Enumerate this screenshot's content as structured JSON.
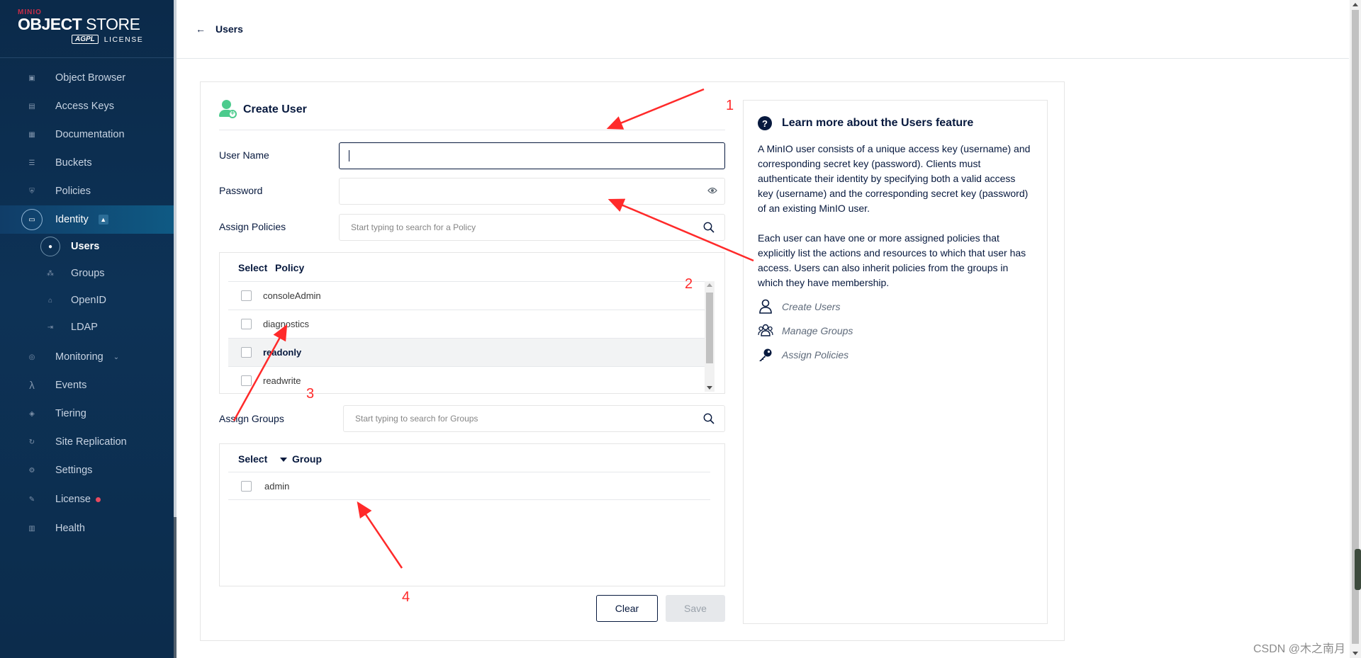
{
  "brand": {
    "line1": "MINIO",
    "title_bold": "OBJECT",
    "title_light": " STORE",
    "badge": "AGPL",
    "license": "LICENSE"
  },
  "nav": {
    "items": [
      {
        "label": "Object Browser",
        "icon": "object-browser-icon"
      },
      {
        "label": "Access Keys",
        "icon": "access-keys-icon"
      },
      {
        "label": "Documentation",
        "icon": "documentation-icon"
      },
      {
        "label": "Buckets",
        "icon": "buckets-icon"
      },
      {
        "label": "Policies",
        "icon": "policies-icon"
      },
      {
        "label": "Identity",
        "icon": "identity-icon"
      }
    ],
    "identity_sub": [
      {
        "label": "Users",
        "icon": "user-icon"
      },
      {
        "label": "Groups",
        "icon": "groups-icon"
      },
      {
        "label": "OpenID",
        "icon": "lock-icon"
      },
      {
        "label": "LDAP",
        "icon": "login-icon"
      }
    ],
    "items_after": [
      {
        "label": "Monitoring",
        "icon": "monitoring-icon"
      },
      {
        "label": "Events",
        "icon": "lambda-icon"
      },
      {
        "label": "Tiering",
        "icon": "tiering-icon"
      },
      {
        "label": "Site Replication",
        "icon": "replication-icon"
      },
      {
        "label": "Settings",
        "icon": "gear-icon"
      },
      {
        "label": "License",
        "icon": "license-icon"
      },
      {
        "label": "Health",
        "icon": "health-icon"
      }
    ]
  },
  "header": {
    "back_label": "Users"
  },
  "form": {
    "title": "Create User",
    "username_label": "User Name",
    "username_value": "",
    "password_label": "Password",
    "password_value": "",
    "assign_policies_label": "Assign Policies",
    "policy_search_placeholder": "Start typing to search for a Policy",
    "policy_table": {
      "headers": [
        "Select",
        "Policy"
      ],
      "rows": [
        "consoleAdmin",
        "diagnostics",
        "readonly",
        "readwrite"
      ]
    },
    "assign_groups_label": "Assign Groups",
    "group_search_placeholder": "Start typing to search for Groups",
    "group_table": {
      "headers": [
        "Select",
        "Group"
      ],
      "rows": [
        "admin"
      ]
    },
    "clear_label": "Clear",
    "save_label": "Save"
  },
  "help": {
    "title": "Learn more about the Users feature",
    "p1": "A MinIO user consists of a unique access key (username) and corresponding secret key (password). Clients must authenticate their identity by specifying both a valid access key (username) and the corresponding secret key (password) of an existing MinIO user.",
    "p2": "Each user can have one or more assigned policies that explicitly list the actions and resources to which that user has access. Users can also inherit policies from the groups in which they have membership.",
    "links": [
      "Create Users",
      "Manage Groups",
      "Assign Policies"
    ]
  },
  "annotations": [
    "1",
    "2",
    "3",
    "4"
  ],
  "watermark": "CSDN @木之南月",
  "colors": {
    "sidebar": "#0b2a4a",
    "accent_green": "#4ccb8d",
    "brand_red": "#c72c48",
    "annotation_red": "#ff2a2a"
  }
}
